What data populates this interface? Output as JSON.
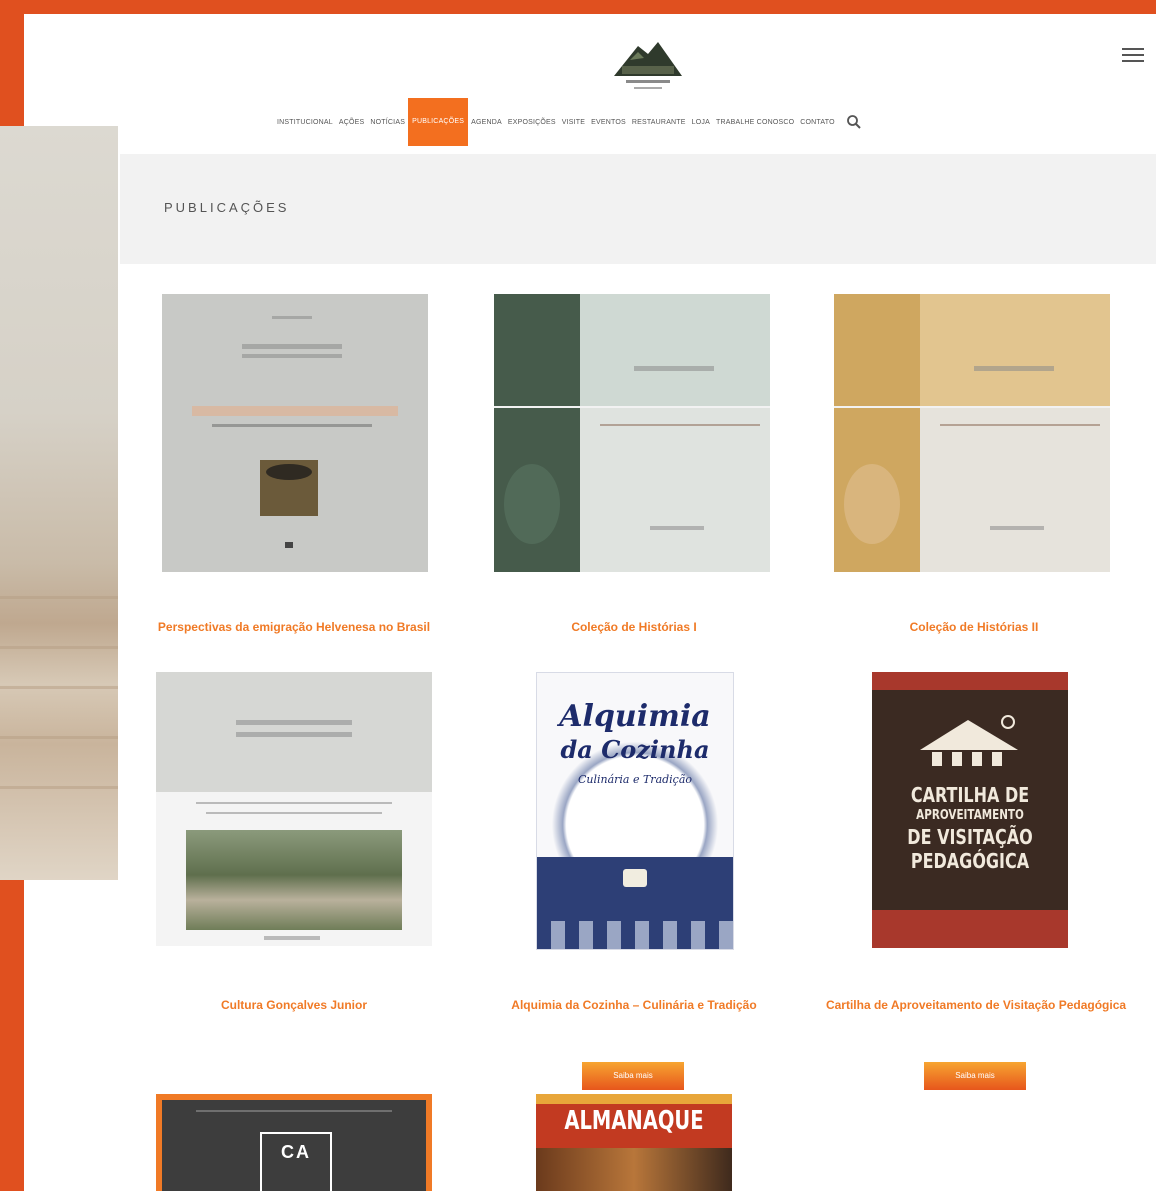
{
  "header": {
    "nav_items": [
      {
        "label": "Institucional",
        "active": false
      },
      {
        "label": "Ações",
        "active": false
      },
      {
        "label": "Notícias",
        "active": false
      },
      {
        "label": "Publicações",
        "active": true
      },
      {
        "label": "Agenda",
        "active": false
      },
      {
        "label": "Exposições",
        "active": false
      },
      {
        "label": "Visite",
        "active": false
      },
      {
        "label": "Eventos",
        "active": false
      },
      {
        "label": "Restaurante",
        "active": false
      },
      {
        "label": "Loja",
        "active": false
      },
      {
        "label": "Trabalhe Conosco",
        "active": false
      },
      {
        "label": "Contato",
        "active": false
      }
    ],
    "accent_color": "#f36f1f"
  },
  "page_title": "PUBLICAÇÕES",
  "publications": [
    {
      "title": "Perspectivas da emigração Helvenesa no Brasil"
    },
    {
      "title": "Coleção de Histórias I"
    },
    {
      "title": "Coleção de Histórias II"
    },
    {
      "title": "Cultura Gonçalves Junior"
    },
    {
      "title": "Alquimia da Cozinha – Culinária e Tradição",
      "button_label": "Saiba mais",
      "cover_text": [
        "Alquimia",
        "da Cozinha",
        "Culinária e Tradição"
      ]
    },
    {
      "title": "Cartilha de Aproveitamento de Visitação Pedagógica",
      "button_label": "Saiba mais",
      "cover_text": [
        "CARTILHA DE",
        "APROVEITAMENTO",
        "DE VISITAÇÃO",
        "PEDAGÓGICA"
      ]
    },
    {
      "title": "",
      "cover_text": [
        "CA"
      ]
    },
    {
      "title": "",
      "cover_text": [
        "ALMANAQUE"
      ]
    }
  ],
  "colors": {
    "frame": "#e0501f",
    "title_link": "#f07a26"
  }
}
